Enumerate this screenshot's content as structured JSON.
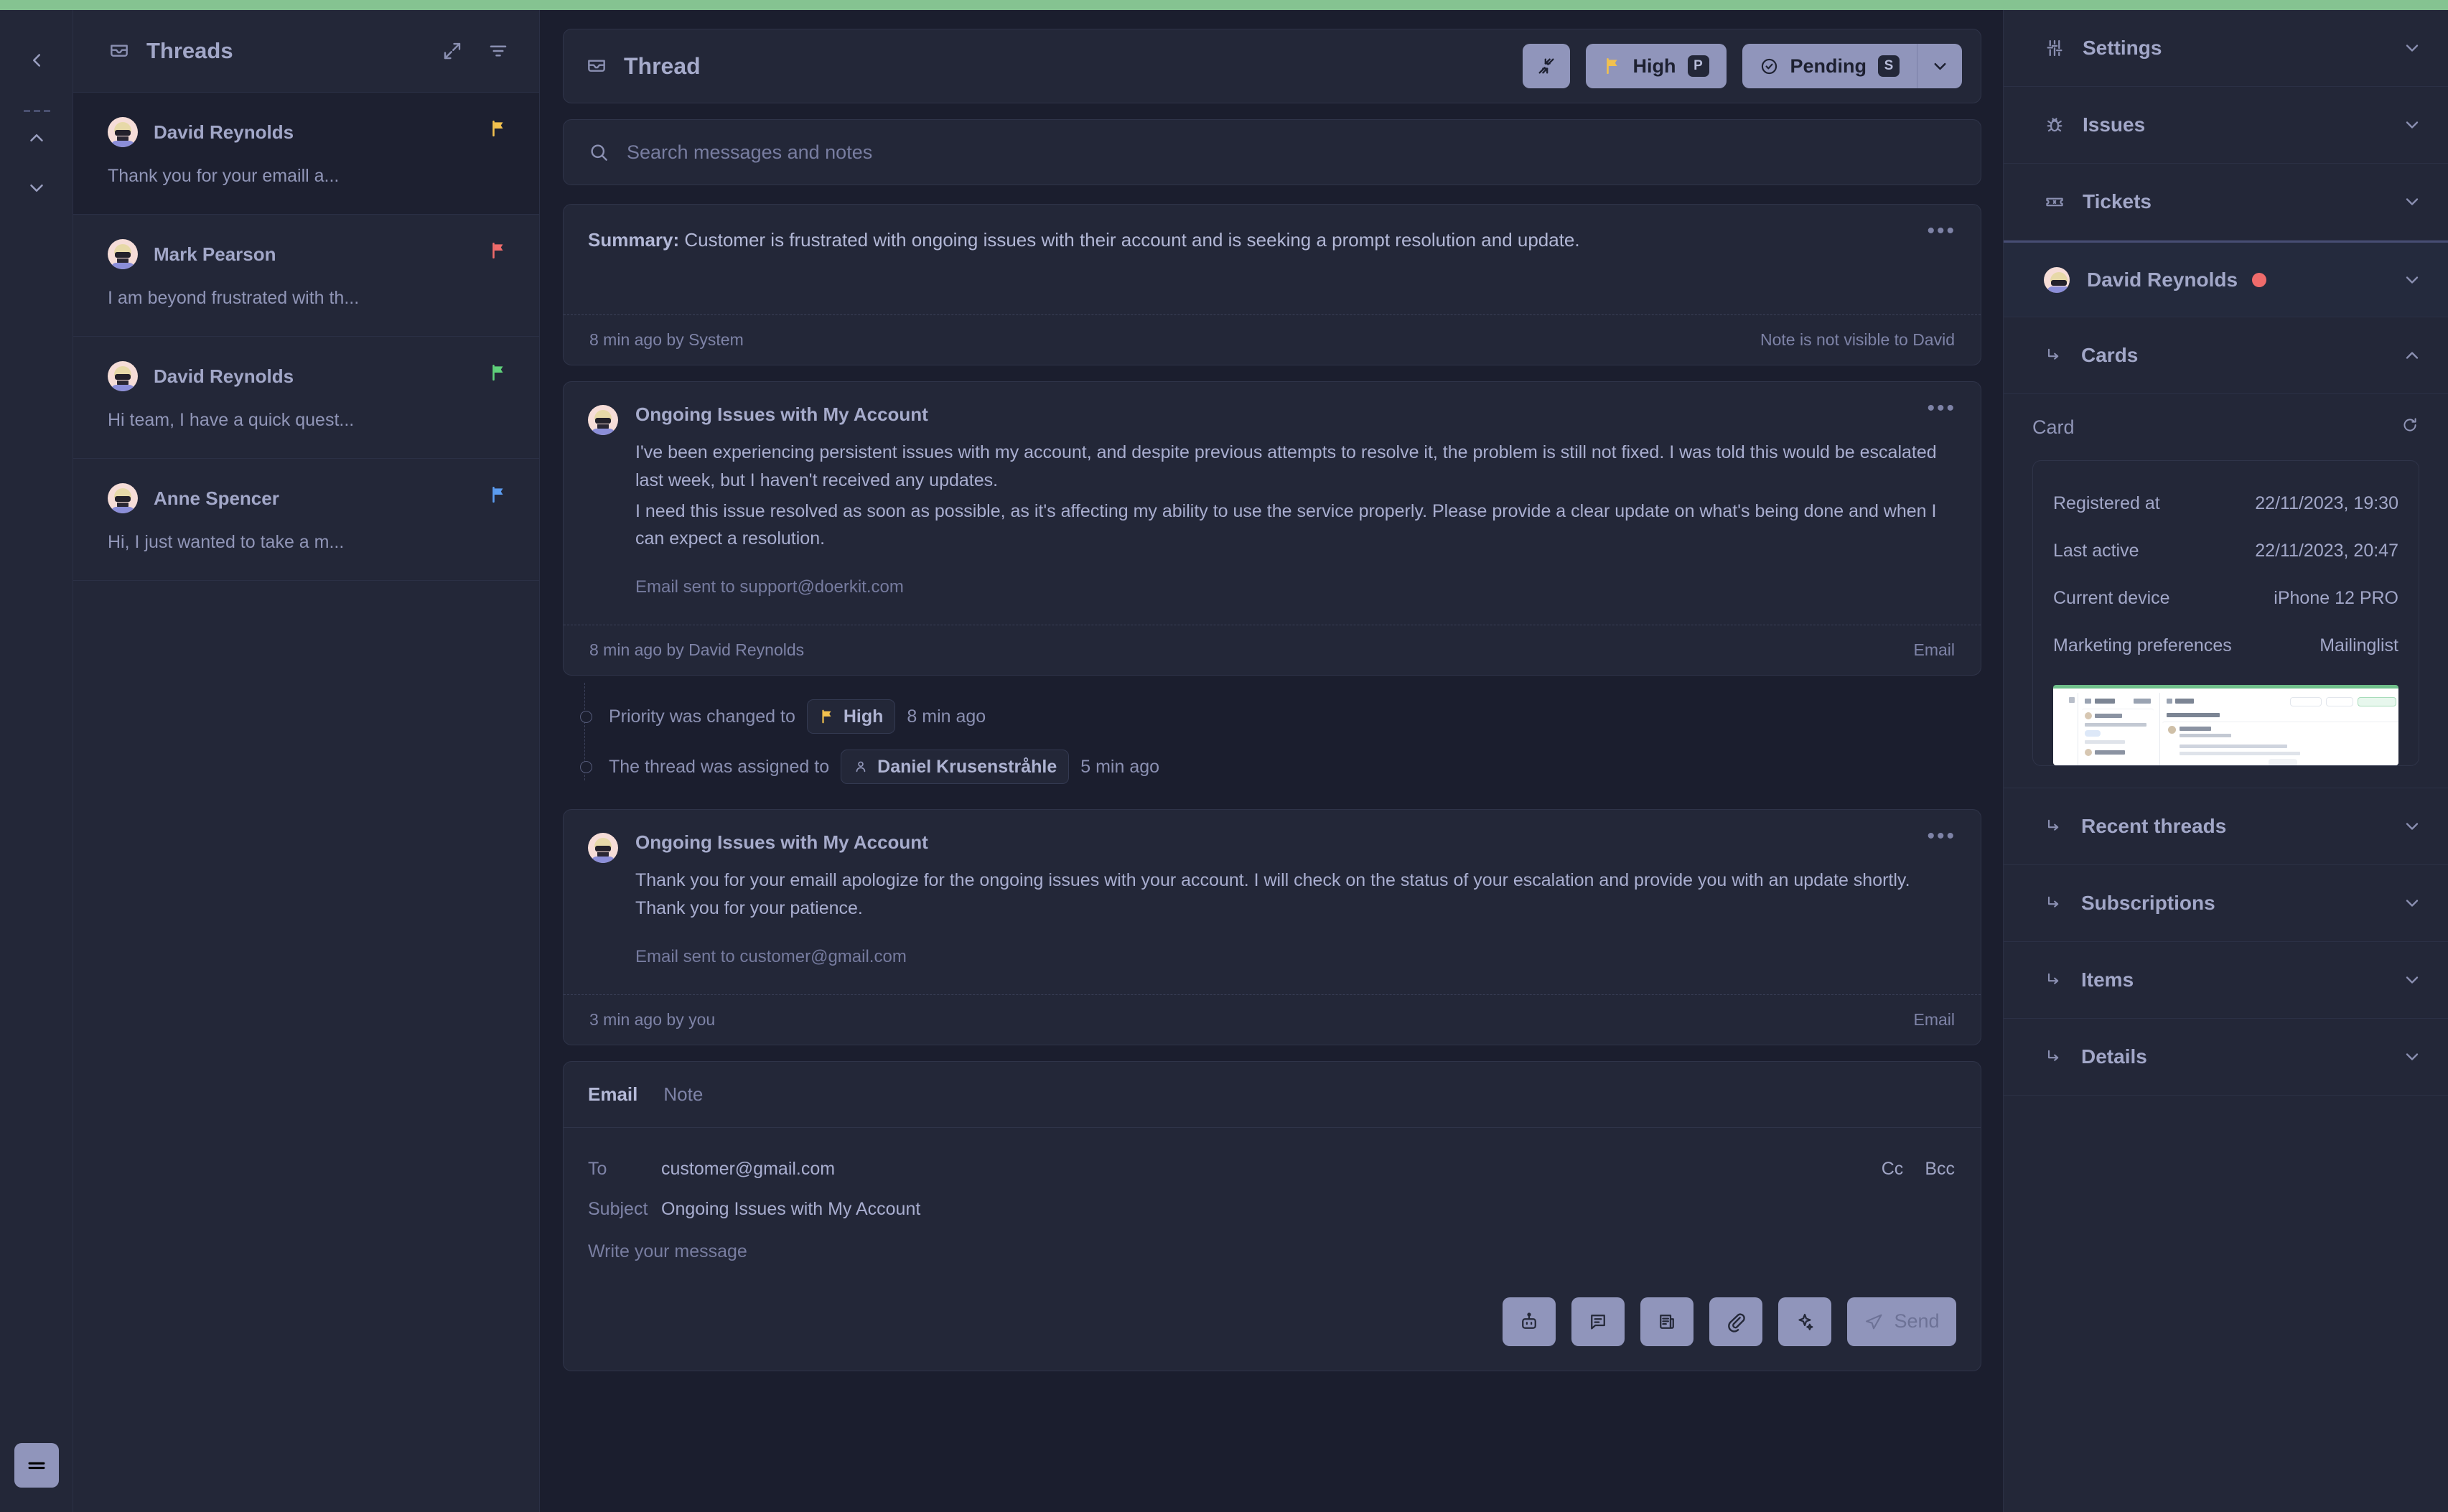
{
  "app": {
    "accent_green": "#85c391",
    "accent_purple": "#9095bb"
  },
  "rail": {
    "back_label": "‹",
    "up_label": "^",
    "down_label": "v",
    "menu_label": "☰"
  },
  "threads_panel": {
    "title": "Threads",
    "expand_icon": "expand-icon",
    "filter_icon": "filter-icon",
    "items": [
      {
        "name": "David Reynolds",
        "snippet": "Thank you for your emaill a...",
        "flag_color": "#f2c14e",
        "selected": true
      },
      {
        "name": "Mark Pearson",
        "snippet": "I am beyond frustrated with th...",
        "flag_color": "#ef6b6b",
        "selected": false
      },
      {
        "name": "David Reynolds",
        "snippet": "Hi team, I have a quick quest...",
        "flag_color": "#5fd17a",
        "selected": false
      },
      {
        "name": "Anne Spencer",
        "snippet": "Hi, I just wanted to take a m...",
        "flag_color": "#5b9cf0",
        "selected": false
      }
    ]
  },
  "thread": {
    "title": "Thread",
    "collapse_icon": "collapse-arrows-icon",
    "priority": {
      "label": "High",
      "shortcut": "P",
      "flag_color": "#f2c14e"
    },
    "status": {
      "label": "Pending",
      "shortcut": "S",
      "caret": "chevron-down-icon"
    },
    "search": {
      "placeholder": "Search messages and notes",
      "value": ""
    }
  },
  "summary_note": {
    "label": "Summary:",
    "text": " Customer is frustrated with ongoing issues with their account and is seeking a prompt resolution and update.",
    "footer_left": "8 min ago by System",
    "footer_right": "Note is not visible to David"
  },
  "messages": [
    {
      "subject": "Ongoing Issues with My Account",
      "paragraphs": [
        "I've been experiencing persistent issues with my account, and despite previous attempts to resolve it, the problem is still not fixed. I was told this would be escalated last week, but I haven't received any updates.",
        "I need this issue resolved as soon as possible, as it's affecting my ability to use the service properly. Please provide a clear update on what's being done and when I can expect a resolution."
      ],
      "sent_to": "Email sent to support@doerkit.com",
      "footer_left": "8 min ago by David Reynolds",
      "footer_right": "Email"
    },
    {
      "subject": "Ongoing Issues with My Account",
      "paragraphs": [
        "Thank you for your emaill apologize for the ongoing issues with your account. I will check on the status of your escalation and provide you with an update shortly. Thank you for your patience."
      ],
      "sent_to": "Email sent to customer@gmail.com",
      "footer_left": "3 min ago by you",
      "footer_right": "Email"
    }
  ],
  "timeline": [
    {
      "label": "Priority was changed to",
      "chip": "High",
      "chip_icon": "flag-icon",
      "time": "8 min ago"
    },
    {
      "label": "The thread was assigned to",
      "chip": "Daniel Krusenstråhle",
      "chip_icon": "person-icon",
      "time": "5 min ago"
    }
  ],
  "composer": {
    "tabs": [
      {
        "label": "Email",
        "active": true
      },
      {
        "label": "Note",
        "active": false
      }
    ],
    "to_label": "To",
    "to_value": "customer@gmail.com",
    "cc_label": "Cc",
    "bcc_label": "Bcc",
    "subject_label": "Subject",
    "subject_value": "Ongoing Issues with My Account",
    "body_placeholder": "Write your message",
    "actions": [
      {
        "icon": "robot-icon"
      },
      {
        "icon": "chat-bubble-icon"
      },
      {
        "icon": "article-icon"
      },
      {
        "icon": "paperclip-icon"
      },
      {
        "icon": "sparkles-icon"
      }
    ],
    "send_label": "Send",
    "send_icon": "paper-plane-icon"
  },
  "sidebar": {
    "rows": [
      {
        "label": "Settings",
        "icon": "sliders-icon",
        "caret": "chevron-down-icon",
        "kind": "top"
      },
      {
        "label": "Issues",
        "icon": "bug-icon",
        "caret": "chevron-down-icon",
        "kind": "top"
      },
      {
        "label": "Tickets",
        "icon": "ticket-icon",
        "caret": "chevron-down-icon",
        "kind": "top"
      },
      {
        "label": "David Reynolds",
        "icon": "avatar",
        "caret": "chevron-down-icon",
        "kind": "contact",
        "online": true
      },
      {
        "label": "Cards",
        "icon": "arrow-branch-icon",
        "caret": "chevron-up-icon",
        "kind": "sub"
      }
    ],
    "rows_after_card": [
      {
        "label": "Recent threads",
        "icon": "arrow-branch-icon",
        "caret": "chevron-down-icon"
      },
      {
        "label": "Subscriptions",
        "icon": "arrow-branch-icon",
        "caret": "chevron-down-icon"
      },
      {
        "label": "Items",
        "icon": "arrow-branch-icon",
        "caret": "chevron-down-icon"
      },
      {
        "label": "Details",
        "icon": "arrow-branch-icon",
        "caret": "chevron-down-icon"
      }
    ],
    "card": {
      "heading": "Card",
      "refresh_icon": "refresh-icon",
      "rows": [
        {
          "key": "Registered at",
          "value": "22/11/2023, 19:30"
        },
        {
          "key": "Last active",
          "value": "22/11/2023, 20:47"
        },
        {
          "key": "Current device",
          "value": "iPhone 12 PRO"
        },
        {
          "key": "Marketing preferences",
          "value": "Mailinglist"
        }
      ],
      "preview_alt": "screenshot-preview"
    }
  }
}
